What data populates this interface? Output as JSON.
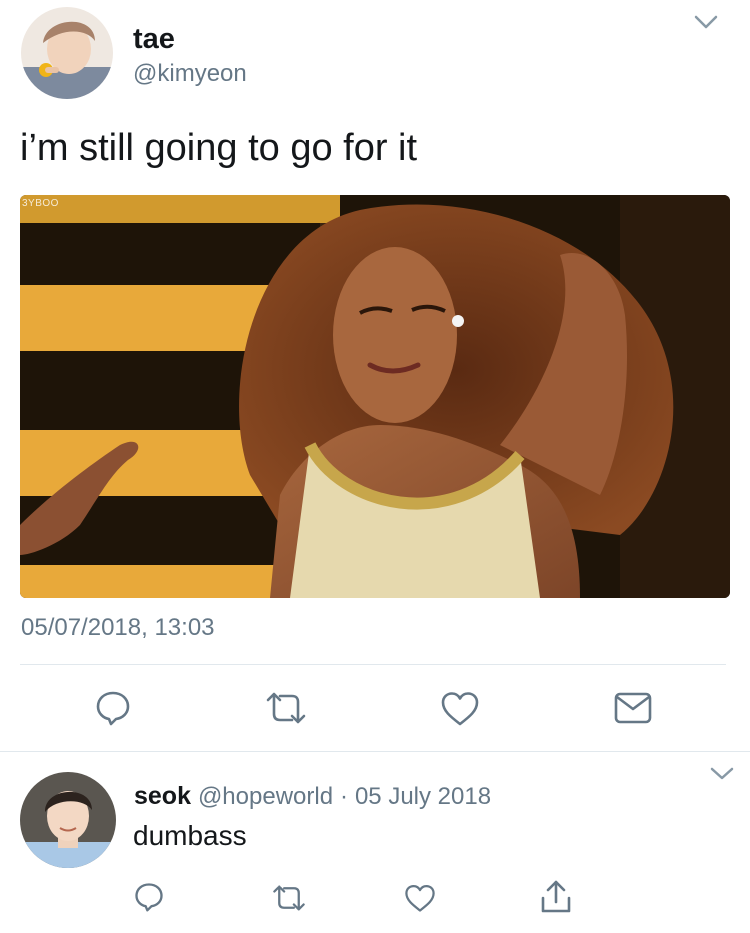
{
  "main_tweet": {
    "display_name": "tae",
    "handle": "@kimyeon",
    "text": "i’m still going to go for it",
    "media_watermark": "3YBOO",
    "timestamp": "05/07/2018, 13:03",
    "actions": [
      "reply-icon",
      "retweet-icon",
      "like-icon",
      "message-icon"
    ]
  },
  "reply_tweet": {
    "display_name": "seok",
    "handle": "@hopeworld",
    "separator": "·",
    "date": "05 July 2018",
    "text": "dumbass",
    "actions": [
      "reply-icon",
      "retweet-icon",
      "like-icon",
      "share-icon"
    ]
  },
  "colors": {
    "text_primary": "#14171a",
    "text_muted": "#657786",
    "icon": "#657786",
    "divider": "#e1e8ed",
    "background": "#ffffff"
  }
}
